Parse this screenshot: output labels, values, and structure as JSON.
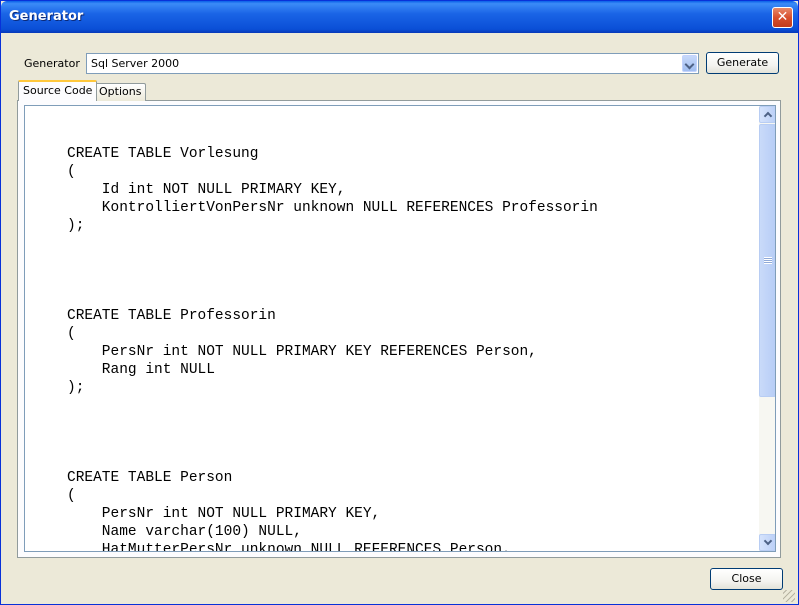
{
  "window": {
    "title": "Generator",
    "close_glyph": "✕"
  },
  "generator": {
    "label": "Generator",
    "selected": "Sql Server 2000",
    "generate_label": "Generate"
  },
  "tabs": [
    {
      "label": "Source Code",
      "active": true
    },
    {
      "label": "Options",
      "active": false
    }
  ],
  "source_code": "CREATE TABLE Vorlesung\n(\n    Id int NOT NULL PRIMARY KEY,\n    KontrolliertVonPersNr unknown NULL REFERENCES Professorin\n);\n\n\n\n\nCREATE TABLE Professorin\n(\n    PersNr int NOT NULL PRIMARY KEY REFERENCES Person,\n    Rang int NULL\n);\n\n\n\n\nCREATE TABLE Person\n(\n    PersNr int NOT NULL PRIMARY KEY,\n    Name varchar(100) NULL,\n    HatMutterPersNr unknown NULL REFERENCES Person,\n    HatVaterPersNr unknown NULL REFERENCES Person",
  "footer": {
    "close_label": "Close"
  },
  "colors": {
    "titlebar": "#0a4fd6",
    "window_bg": "#ece9d8",
    "tab_accent": "#ffc83c"
  }
}
